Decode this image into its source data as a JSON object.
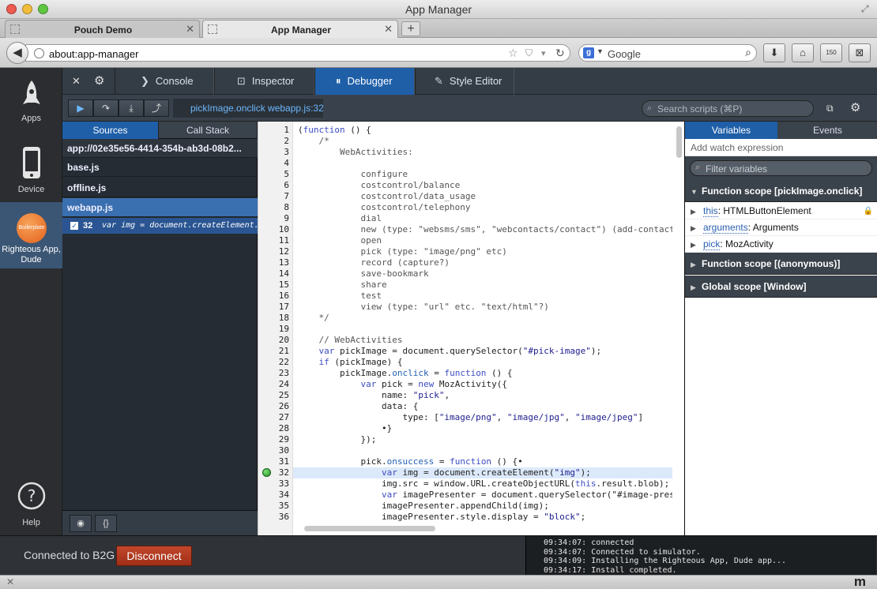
{
  "window": {
    "title": "App Manager"
  },
  "tabs": [
    {
      "label": "Pouch Demo"
    },
    {
      "label": "App Manager"
    }
  ],
  "nav": {
    "url": "about:app-manager",
    "search_placeholder": "Google"
  },
  "app_sidebar": {
    "items": [
      {
        "label": "Apps"
      },
      {
        "label": "Device"
      },
      {
        "label": "Righteous App, Dude",
        "logo_text": "Boilerplate"
      },
      {
        "label": "Help"
      }
    ]
  },
  "devtools": {
    "tabs": [
      {
        "label": "Console"
      },
      {
        "label": "Inspector"
      },
      {
        "label": "Debugger"
      },
      {
        "label": "Style Editor"
      }
    ],
    "selected_tab": "Debugger"
  },
  "debugger": {
    "breadcrumb": "pickImage.onclick webapp.js:32",
    "search_placeholder": "Search scripts (⌘P)"
  },
  "sources": {
    "tabs": [
      {
        "label": "Sources"
      },
      {
        "label": "Call Stack"
      }
    ],
    "origin": "app://02e35e56-4414-354b-ab3d-08b2...",
    "files": [
      {
        "name": "base.js"
      },
      {
        "name": "offline.js"
      },
      {
        "name": "webapp.js"
      }
    ],
    "breakpoint": {
      "line": "32",
      "code": "var img = document.createElement..."
    }
  },
  "editor": {
    "lines": [
      "(function () {",
      "    /*",
      "        WebActivities:",
      "",
      "            configure",
      "            costcontrol/balance",
      "            costcontrol/data_usage",
      "            costcontrol/telephony",
      "            dial",
      "            new (type: \"websms/sms\", \"webcontacts/contact\") (add-contact",
      "            open",
      "            pick (type: \"image/png\" etc)",
      "            record (capture?)",
      "            save-bookmark",
      "            share",
      "            test",
      "            view (type: \"url\" etc. \"text/html\"?)",
      "    */",
      "",
      "    // WebActivities",
      "    var pickImage = document.querySelector(\"#pick-image\");",
      "    if (pickImage) {",
      "        pickImage.onclick = function () {",
      "            var pick = new MozActivity({",
      "                name: \"pick\",",
      "                data: {",
      "                    type: [\"image/png\", \"image/jpg\", \"image/jpeg\"]",
      "                •}",
      "            });",
      "",
      "            pick.onsuccess = function () {•",
      "                var img = document.createElement(\"img\");",
      "                img.src = window.URL.createObjectURL(this.result.blob);",
      "                var imagePresenter = document.querySelector(\"#image-pres",
      "                imagePresenter.appendChild(img);",
      "                imagePresenter.style.display = \"block\";"
    ],
    "current_line": 32
  },
  "variables": {
    "tabs": [
      {
        "label": "Variables"
      },
      {
        "label": "Events"
      }
    ],
    "watch_placeholder": "Add watch expression",
    "filter_placeholder": "Filter variables",
    "scopes": [
      {
        "label": "Function scope [pickImage.onclick]"
      },
      {
        "label": "Function scope [(anonymous)]"
      },
      {
        "label": "Global scope [Window]"
      }
    ],
    "vars": [
      {
        "name": "this",
        "value": "HTMLButtonElement"
      },
      {
        "name": "arguments",
        "value": "Arguments"
      },
      {
        "name": "pick",
        "value": "MozActivity"
      }
    ]
  },
  "connection": {
    "status": "Connected to B2G",
    "button": "Disconnect",
    "log": [
      "09:34:07: connected",
      "09:34:07: Connected to simulator.",
      "09:34:09: Installing the Righteous App, Dude app...",
      "09:34:17: Install completed."
    ]
  },
  "colors": {
    "accent": "#1f5fa8",
    "danger": "#b23a20"
  }
}
